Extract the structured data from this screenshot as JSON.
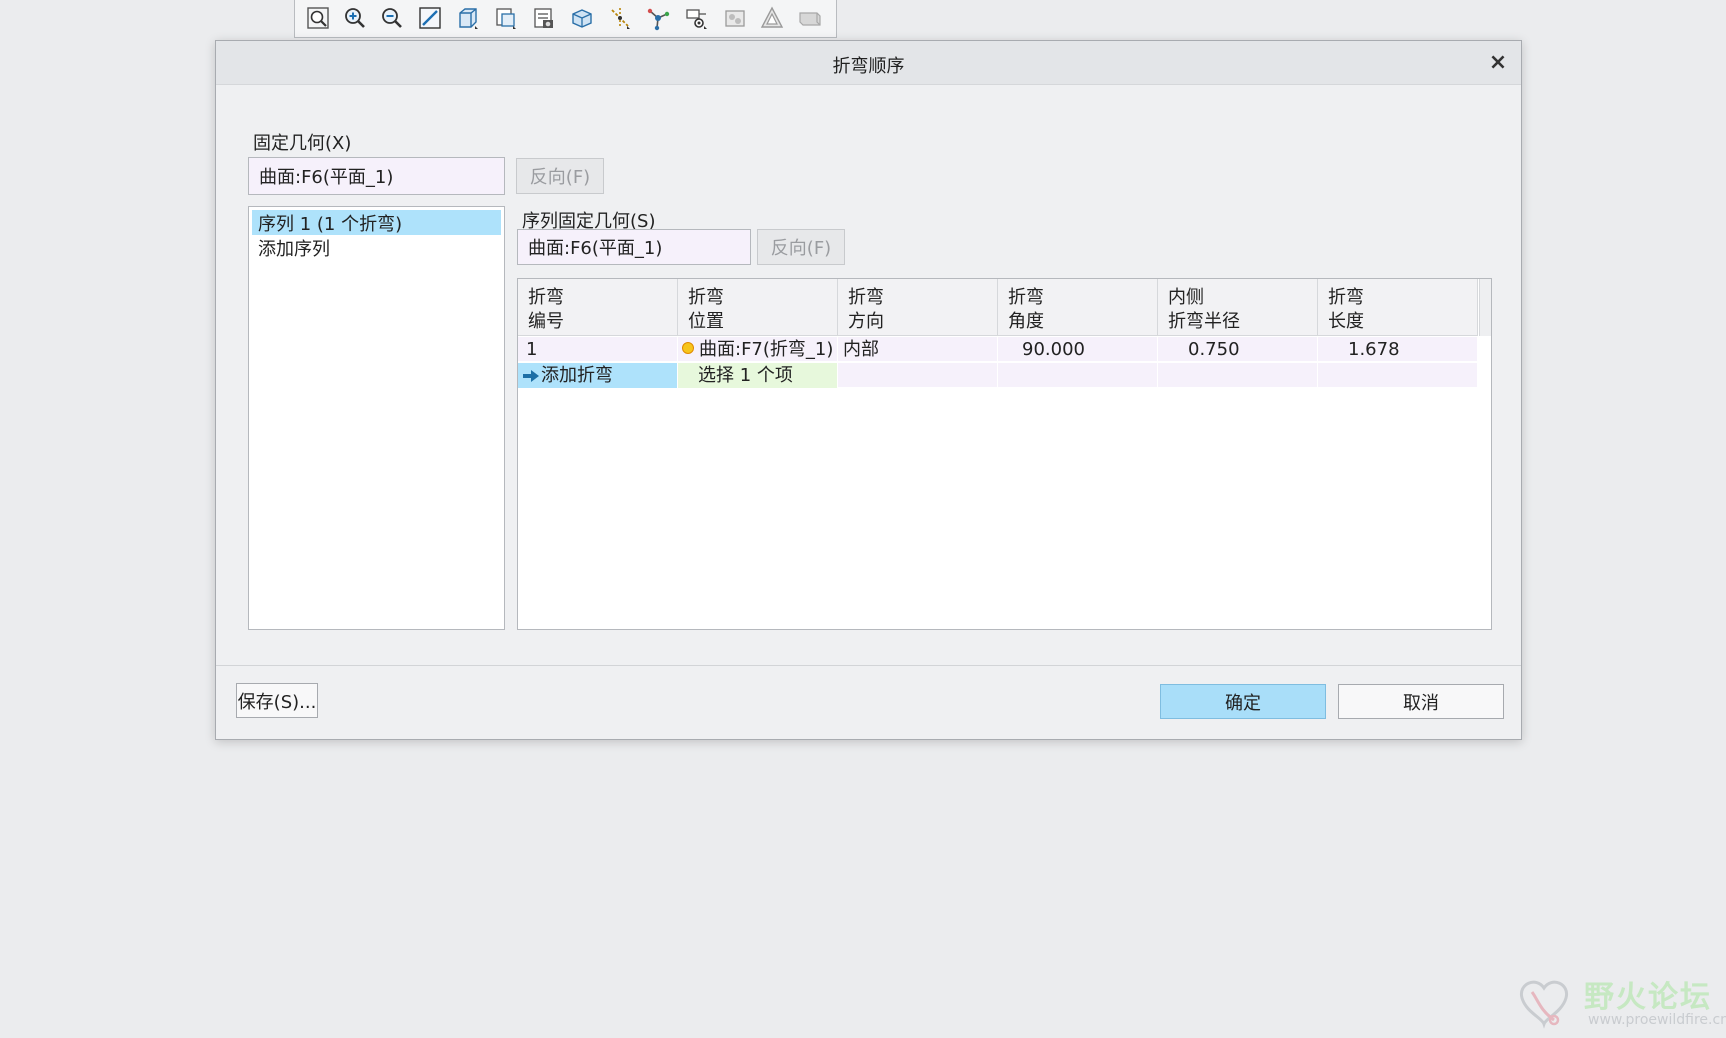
{
  "toolbar": {
    "icons": [
      "zoom-fit-icon",
      "zoom-in-icon",
      "zoom-out-icon",
      "repaint-icon",
      "view-cube-icon",
      "saved-views-icon",
      "view-manager-icon",
      "display-style-icon",
      "datum-display-icon",
      "spin-center-icon",
      "annotation-display-icon",
      "appearance-icon",
      "perspective-icon",
      "sketch-view-icon"
    ]
  },
  "dialog": {
    "title": "折弯顺序",
    "close_glyph": "×",
    "fixed_geometry": {
      "label": "固定几何(X)",
      "value": "曲面:F6(平面_1)",
      "flip_button": "反向(F)"
    },
    "sequences": {
      "items": [
        {
          "label": "序列 1 (1 个折弯)",
          "selected": true
        },
        {
          "label": "添加序列",
          "selected": false
        }
      ]
    },
    "sequence_fixed_geometry": {
      "label": "序列固定几何(S)",
      "value": "曲面:F6(平面_1)",
      "flip_button": "反向(F)"
    },
    "table": {
      "columns": [
        {
          "line1": "折弯",
          "line2": "编号"
        },
        {
          "line1": "折弯",
          "line2": "位置"
        },
        {
          "line1": "折弯",
          "line2": "方向"
        },
        {
          "line1": "折弯",
          "line2": "角度"
        },
        {
          "line1": "内侧",
          "line2": "折弯半径"
        },
        {
          "line1": "折弯",
          "line2": "长度"
        }
      ],
      "rows": [
        {
          "number": "1",
          "location": "曲面:F7(折弯_1)",
          "direction": "内部",
          "angle": "90.000",
          "inner_radius": "0.750",
          "length": "1.678"
        }
      ],
      "add_row": {
        "label": "添加折弯",
        "prompt": "选择 1 个项"
      }
    },
    "footer": {
      "save_label": "保存(S)...",
      "ok_label": "确定",
      "cancel_label": "取消"
    }
  },
  "watermark": {
    "title": "野火论坛",
    "url": "www.proewildfire.cn"
  },
  "colors": {
    "selection": "#aee2fb",
    "field_bg": "#f6f1fb",
    "select_cell_bg": "#e7f8dc",
    "ok_button": "#a9def9",
    "row_dot": "#f6c51c"
  }
}
